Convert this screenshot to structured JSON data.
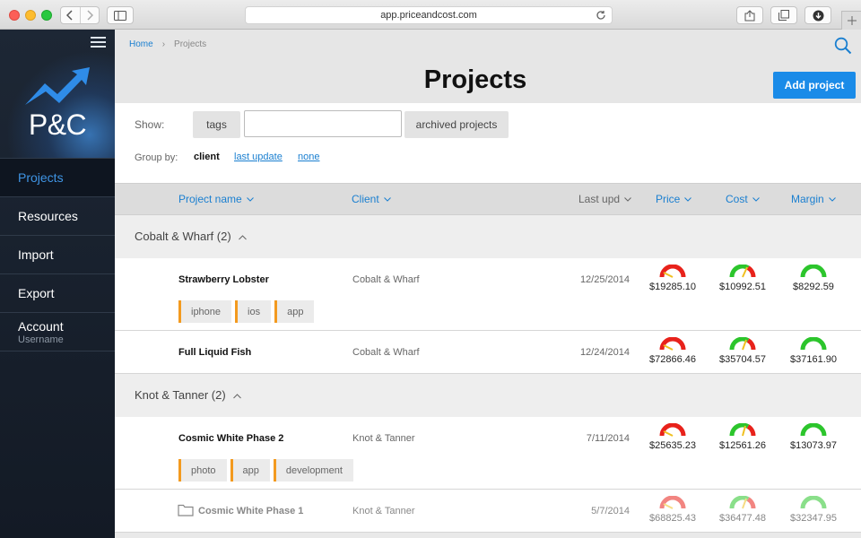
{
  "browser": {
    "url": "app.priceandcost.com"
  },
  "sidebar": {
    "logo_text": "P&C",
    "items": [
      {
        "label": "Projects",
        "active": true
      },
      {
        "label": "Resources"
      },
      {
        "label": "Import"
      },
      {
        "label": "Export"
      },
      {
        "label": "Account",
        "sub": "Username"
      }
    ]
  },
  "header": {
    "breadcrumb": {
      "home": "Home",
      "current": "Projects"
    },
    "title": "Projects",
    "add_button": "Add project"
  },
  "filters": {
    "show_label": "Show:",
    "tags_button": "tags",
    "tags_input_value": "",
    "archived_button": "archived projects",
    "group_label": "Group by:",
    "group_options": [
      {
        "label": "client",
        "selected": true
      },
      {
        "label": "last update"
      },
      {
        "label": "none"
      }
    ]
  },
  "table": {
    "columns": {
      "name": "Project name",
      "client": "Client",
      "last_update": "Last upd",
      "price": "Price",
      "cost": "Cost",
      "margin": "Margin"
    },
    "groups": [
      {
        "label": "Cobalt & Wharf (2)",
        "rows": [
          {
            "name": "Strawberry Lobster",
            "client": "Cobalt & Wharf",
            "date": "12/25/2014",
            "price": "$19285.10",
            "cost": "$10992.51",
            "margin": "$8292.59",
            "tags": [
              "iphone",
              "ios",
              "app"
            ]
          },
          {
            "name": "Full Liquid Fish",
            "client": "Cobalt & Wharf",
            "date": "12/24/2014",
            "price": "$72866.46",
            "cost": "$35704.57",
            "margin": "$37161.90",
            "tags": []
          }
        ]
      },
      {
        "label": "Knot & Tanner (2)",
        "rows": [
          {
            "name": "Cosmic White Phase 2",
            "client": "Knot & Tanner",
            "date": "7/11/2014",
            "price": "$25635.23",
            "cost": "$12561.26",
            "margin": "$13073.97",
            "tags": [
              "photo",
              "app",
              "development"
            ]
          },
          {
            "name": "Cosmic White Phase 1",
            "client": "Knot & Tanner",
            "date": "5/7/2014",
            "price": "$68825.43",
            "cost": "$36477.48",
            "margin": "$32347.95",
            "tags": [],
            "archived": true
          }
        ]
      }
    ]
  },
  "colors": {
    "accent": "#1a8be8",
    "link": "#1a7fd0",
    "tag_stripe": "#f39a1f",
    "gauge_red": "#e8221b",
    "gauge_green": "#2cc52c"
  }
}
